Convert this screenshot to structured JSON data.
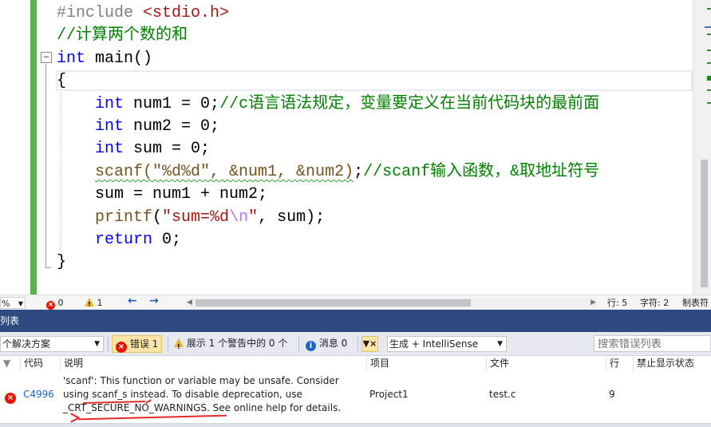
{
  "editor": {
    "lines": [
      {
        "tokens": [
          {
            "t": "#include ",
            "c": "pre"
          },
          {
            "t": "<stdio.h>",
            "c": "str"
          }
        ]
      },
      {
        "tokens": [
          {
            "t": "//计算两个数的和",
            "c": "cmt"
          }
        ]
      },
      {
        "tokens": [
          {
            "t": "int",
            "c": "kw"
          },
          {
            "t": " main()",
            "c": ""
          }
        ]
      },
      {
        "tokens": [
          {
            "t": "{",
            "c": ""
          }
        ]
      },
      {
        "tokens": [
          {
            "t": "    ",
            "c": ""
          },
          {
            "t": "int",
            "c": "kw"
          },
          {
            "t": " num1 = 0;",
            "c": ""
          },
          {
            "t": "//c语言语法规定，变量要定义在当前代码块的最前面",
            "c": "cmt"
          }
        ]
      },
      {
        "tokens": [
          {
            "t": "    ",
            "c": ""
          },
          {
            "t": "int",
            "c": "kw"
          },
          {
            "t": " num2 = 0;",
            "c": ""
          }
        ]
      },
      {
        "tokens": [
          {
            "t": "    ",
            "c": ""
          },
          {
            "t": "int",
            "c": "kw"
          },
          {
            "t": " sum = 0;",
            "c": ""
          }
        ]
      },
      {
        "tokens": [
          {
            "t": "    ",
            "c": ""
          },
          {
            "t": "scanf(\"%d%d\", &num1, &num2)",
            "c": "fn squiggle"
          },
          {
            "t": ";",
            "c": ""
          },
          {
            "t": "//scanf输入函数，&取地址符号",
            "c": "cmt"
          }
        ]
      },
      {
        "tokens": [
          {
            "t": "    sum = num1 + num2;",
            "c": ""
          }
        ]
      },
      {
        "tokens": [
          {
            "t": "    ",
            "c": ""
          },
          {
            "t": "printf",
            "c": "fn"
          },
          {
            "t": "(",
            "c": ""
          },
          {
            "t": "\"sum=%d",
            "c": "str"
          },
          {
            "t": "\\n",
            "c": "esc"
          },
          {
            "t": "\"",
            "c": "str"
          },
          {
            "t": ", sum);",
            "c": ""
          }
        ]
      },
      {
        "tokens": [
          {
            "t": "    ",
            "c": ""
          },
          {
            "t": "return",
            "c": "kw"
          },
          {
            "t": " 0;",
            "c": ""
          }
        ]
      },
      {
        "tokens": [
          {
            "t": "}",
            "c": ""
          }
        ]
      }
    ],
    "fold_glyph": "−"
  },
  "status": {
    "zoom": "%",
    "errors": "0",
    "warnings": "1",
    "line": "行: 5",
    "char": "字符: 2",
    "tab": "制表符"
  },
  "panel": {
    "title": "列表"
  },
  "toolbar": {
    "scope": "个解决方案",
    "errors_label": "错误 1",
    "warnings_label": "展示 1 个警告中的 0 个",
    "messages_label": "消息 0",
    "build_filter": "生成 + IntelliSense",
    "search_placeholder": "搜索错误列表"
  },
  "table": {
    "headers": [
      "代码",
      "说明",
      "项目",
      "文件",
      "行",
      "禁止显示状态"
    ],
    "rows": [
      {
        "code": "C4996",
        "description": "'scanf': This function or variable may be unsafe. Consider using scanf_s instead. To disable deprecation, use _CRT_SECURE_NO_WARNINGS. See online help for details.",
        "project": "Project1",
        "file": "test.c",
        "line": "9",
        "suppression": ""
      }
    ]
  },
  "colors": {
    "change_bar": "#57b34a",
    "panel_title_bg": "#2e4a81",
    "error_red": "#e51400",
    "annotation_red": "#e52b2b",
    "keyword": "#0000ff",
    "comment": "#008000",
    "string": "#a31515"
  }
}
